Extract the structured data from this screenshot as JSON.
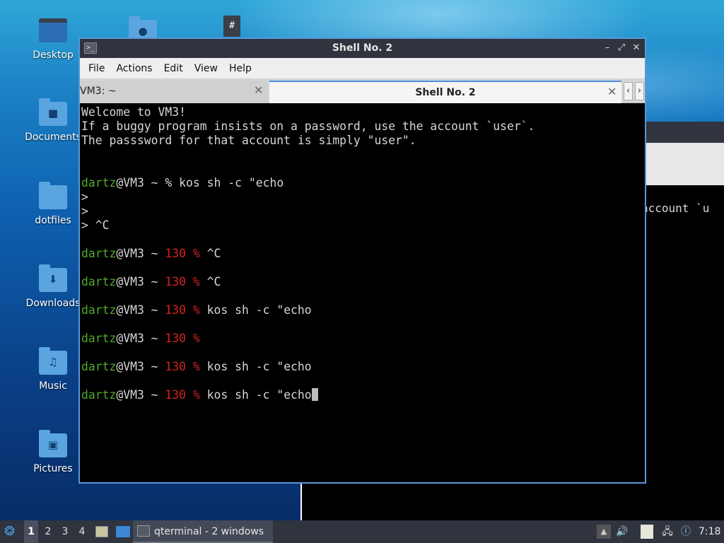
{
  "desktop": {
    "icons": [
      {
        "label": "Desktop",
        "icon": "desktop-icon"
      },
      {
        "label": "Documents",
        "icon": "documents-folder-icon"
      },
      {
        "label": "dotfiles",
        "icon": "folder-icon"
      },
      {
        "label": "Downloads",
        "icon": "downloads-folder-icon"
      },
      {
        "label": "Music",
        "icon": "music-folder-icon"
      },
      {
        "label": "Pictures",
        "icon": "pictures-folder-icon"
      }
    ]
  },
  "background_window": {
    "visible_text": "account `u"
  },
  "window": {
    "title": "Shell No. 2",
    "menu": [
      "File",
      "Actions",
      "Edit",
      "View",
      "Help"
    ],
    "tabs": [
      {
        "label": "VM3: ~",
        "active": false
      },
      {
        "label": "Shell No. 2",
        "active": true
      }
    ],
    "controls": {
      "minimize": "–",
      "maximize": "⤢",
      "close": "✕"
    },
    "terminal": {
      "motd": [
        "Welcome to VM3!",
        "If a buggy program insists on a password, use the account `user`.",
        "The passsword for that account is simply \"user\"."
      ],
      "user": "dartz",
      "host_path": "@VM3 ~ ",
      "prompt_ok": "% ",
      "status_code": "130",
      "prompt_err": " % ",
      "lines": {
        "l1": "kos sh -c \"echo",
        "cont1": ">",
        "cont2": ">",
        "cont3": "> ^C",
        "l2": "^C",
        "l3": "^C",
        "l4": "kos sh -c \"echo",
        "l5": "",
        "l6": "kos sh -c \"echo",
        "l7": "kos sh -c \"echo"
      }
    }
  },
  "taskbar": {
    "workspaces": [
      "1",
      "2",
      "3",
      "4"
    ],
    "active_workspace": "1",
    "task_label": "qterminal - 2 windows",
    "clock": "7:18",
    "accent": "#4a90d9"
  }
}
